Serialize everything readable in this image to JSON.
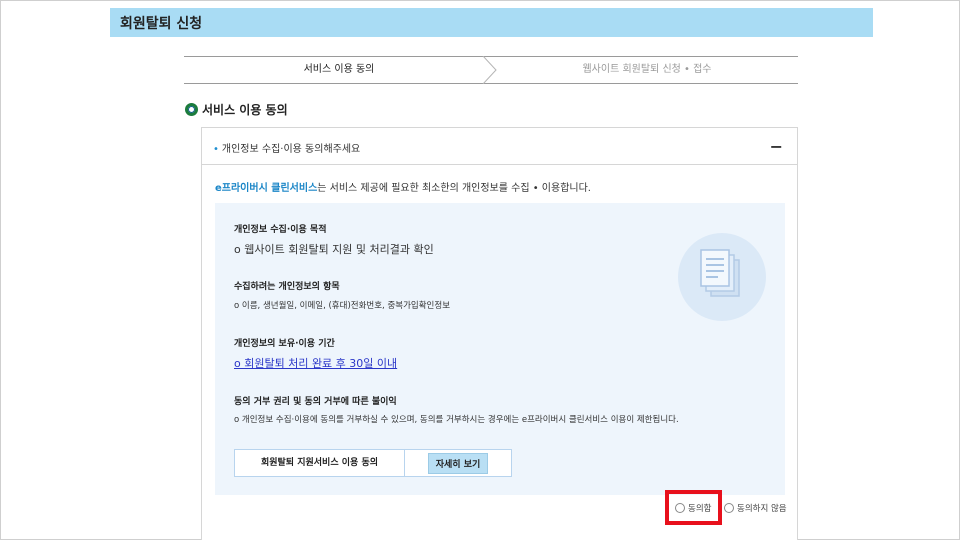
{
  "page": {
    "title": "회원탈퇴 신청"
  },
  "steps": [
    {
      "label": "서비스 이용 동의"
    },
    {
      "label": "웹사이트 회원탈퇴 신청 • 접수"
    }
  ],
  "section": {
    "heading": "서비스 이용 동의"
  },
  "panel": {
    "header_label": "개인정보 수집·이용 동의해주세요",
    "collapse_symbol": "−",
    "intro_brand": "e프라이버시 클린서비스",
    "intro_rest": "는 서비스 제공에 필요한 최소한의 개인정보를 수집 • 이용합니다.",
    "items": [
      {
        "heading": "개인정보 수집·이용 목적",
        "value": "o 웹사이트 회원탈퇴 지원 및 처리결과 확인"
      },
      {
        "heading": "수집하려는 개인정보의 항목",
        "value": "o 이름, 생년월일, 이메일, (휴대)전화번호, 중복가입확인정보"
      },
      {
        "heading": "개인정보의 보유·이용 기간",
        "value": "o 회원탈퇴 처리 완료 후 30일 이내"
      },
      {
        "heading": "동의 거부 권리 및 동의 거부에 따른 불이익",
        "value": "o 개인정보 수집·이용에 동의를 거부하실 수 있으며, 동의를 거부하시는 경우에는 e프라이버시 클린서비스 이용이 제한됩니다."
      }
    ],
    "service_label": "회원탈퇴 지원서비스 이용 동의",
    "detail_button": "자세히 보기"
  },
  "consent": {
    "agree_label": "동의함",
    "disagree_label": "동의하지 않음",
    "highlight_color": "#e8101c"
  },
  "colors": {
    "title_bar": "#a9dcf4",
    "brand": "#1b86c7",
    "link": "#2a36c8",
    "info_box": "#eef5fc"
  }
}
